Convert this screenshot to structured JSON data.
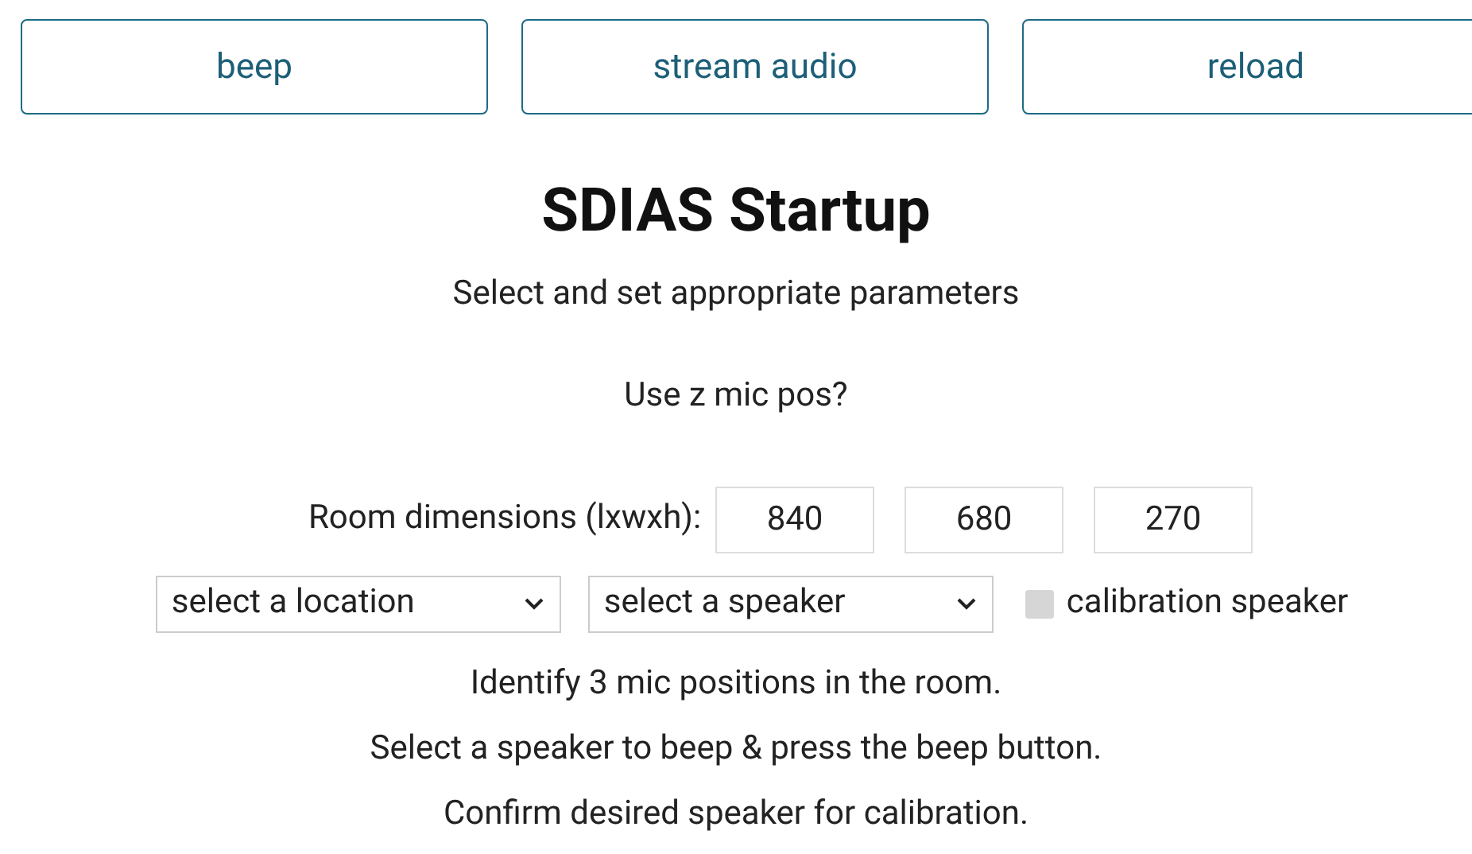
{
  "buttons": [
    "beep",
    "stream audio",
    "reload"
  ],
  "title": "SDIAS Startup",
  "subtitle": "Select and set appropriate parameters",
  "mic_question": "Use z mic pos?",
  "room": {
    "label": "Room dimensions (lxwxh):",
    "values": [
      "840",
      "680",
      "270"
    ]
  },
  "selects": [
    {
      "value": "select a location"
    },
    {
      "value": "select a speaker"
    }
  ],
  "calibration": {
    "label": "calibration speaker",
    "checked": false
  },
  "instructions": [
    "Identify 3 mic positions in the room.",
    "Select a speaker to beep & press the beep button.",
    "Confirm desired speaker for calibration."
  ]
}
